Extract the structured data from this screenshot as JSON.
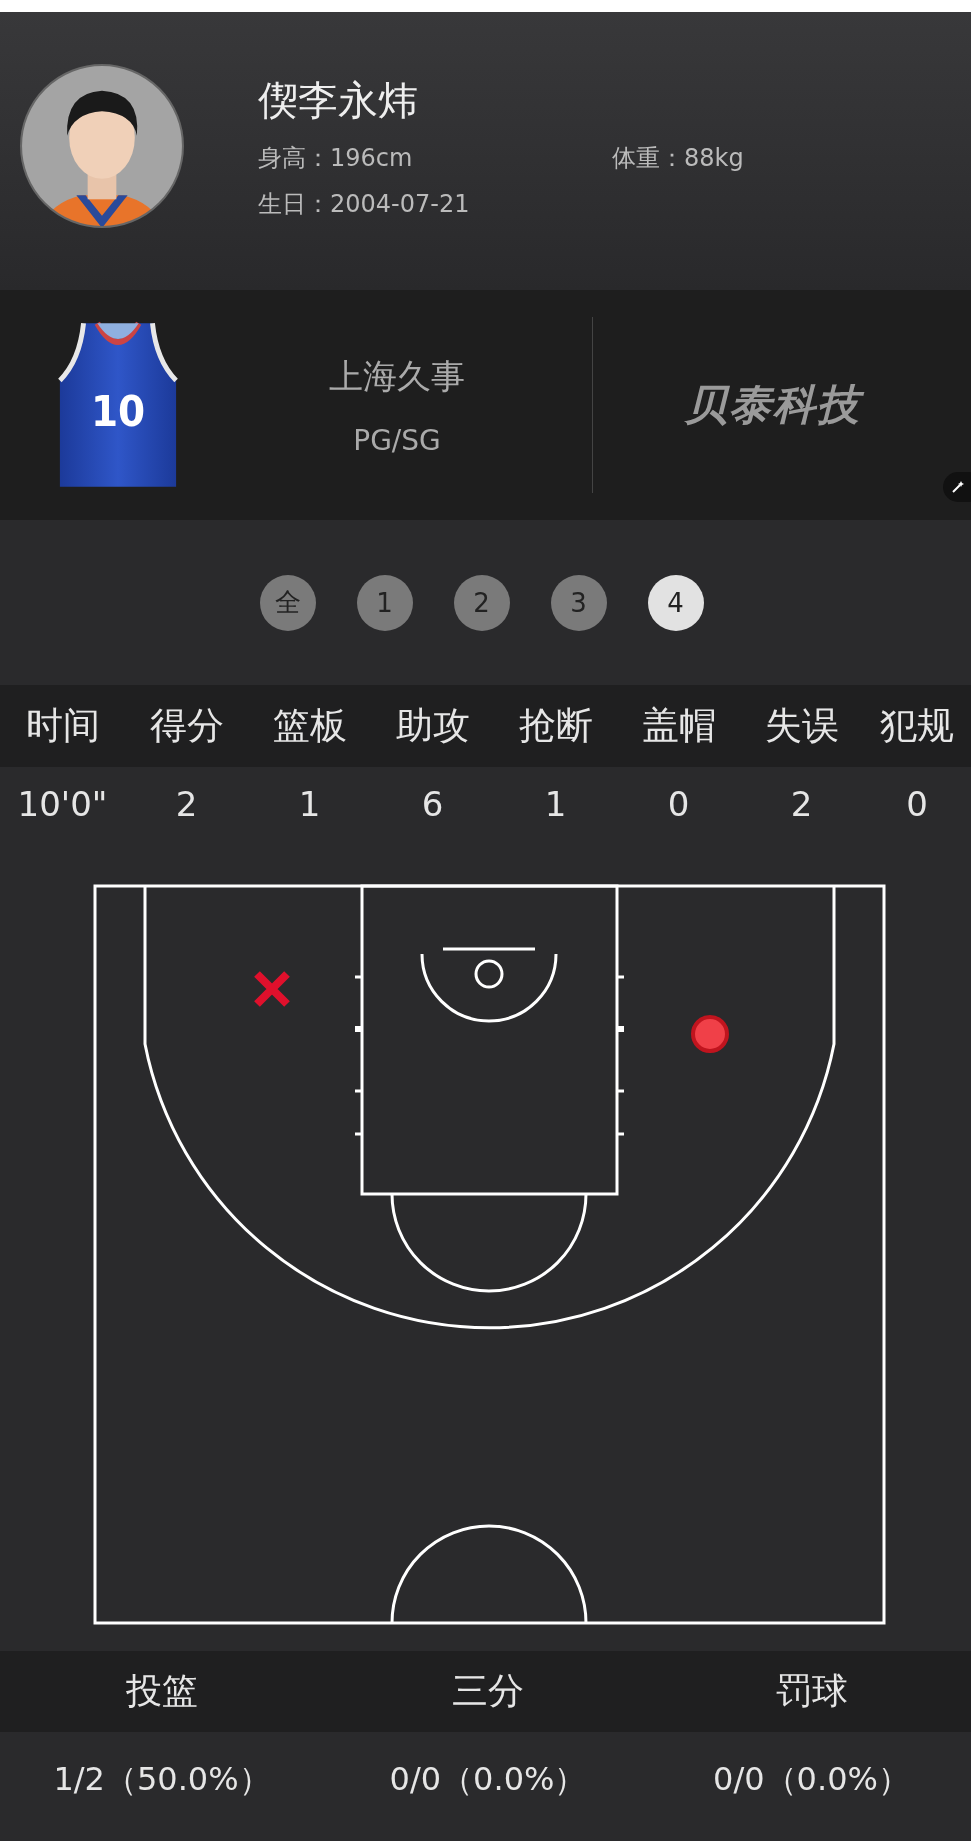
{
  "player": {
    "name": "偰李永炜",
    "height_label": "身高：",
    "height": "196cm",
    "weight_label": "体重：",
    "weight": "88kg",
    "birthday_label": "生日：",
    "birthday": "2004-07-21"
  },
  "team": {
    "jersey_number": "10",
    "name": "上海久事",
    "position": "PG/SG",
    "sponsor": "贝泰科技"
  },
  "periods": [
    {
      "label": "全",
      "selected": false
    },
    {
      "label": "1",
      "selected": false
    },
    {
      "label": "2",
      "selected": false
    },
    {
      "label": "3",
      "selected": false
    },
    {
      "label": "4",
      "selected": true
    }
  ],
  "stats": {
    "columns": [
      "时间",
      "得分",
      "篮板",
      "助攻",
      "抢断",
      "盖帽",
      "失误",
      "犯规"
    ],
    "values": [
      "10'0\"",
      "2",
      "1",
      "6",
      "1",
      "0",
      "2",
      "0"
    ]
  },
  "shots": [
    {
      "made": false
    },
    {
      "made": true
    }
  ],
  "shooting": {
    "columns": [
      "投篮",
      "三分",
      "罚球"
    ],
    "values": [
      "1/2（50.0%）",
      "0/0（0.0%）",
      "0/0（0.0%）"
    ]
  }
}
